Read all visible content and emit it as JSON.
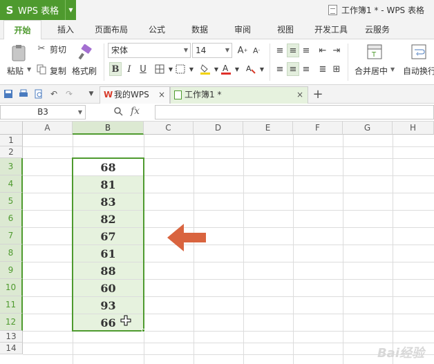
{
  "app": {
    "name": "WPS 表格",
    "logo": "S"
  },
  "window": {
    "title": "工作簿1 * - WPS 表格"
  },
  "ribbon_tabs": [
    "开始",
    "插入",
    "页面布局",
    "公式",
    "数据",
    "审阅",
    "视图",
    "开发工具",
    "云服务"
  ],
  "ribbon": {
    "paste": "粘贴",
    "cut": "剪切",
    "copy": "复制",
    "format_painter": "格式刷",
    "font_name": "宋体",
    "font_size": "14",
    "merge_center": "合并居中",
    "wrap": "自动换行",
    "bold": "B",
    "italic": "I",
    "underline": "U"
  },
  "doc_tabs": [
    {
      "label": "我的WPS"
    },
    {
      "label": "工作簿1 *"
    }
  ],
  "formula_bar": {
    "name_box": "B3",
    "fx": "fx",
    "value": ""
  },
  "grid": {
    "columns": [
      "A",
      "B",
      "C",
      "D",
      "E",
      "F",
      "G",
      "H"
    ],
    "rows": [
      "1",
      "2",
      "3",
      "4",
      "5",
      "6",
      "7",
      "8",
      "9",
      "10",
      "11",
      "12",
      "13",
      "14"
    ],
    "selected_column": "B",
    "selected_range": "B3:B12",
    "values_b": [
      "68",
      "81",
      "83",
      "82",
      "67",
      "61",
      "88",
      "60",
      "93",
      "66"
    ]
  },
  "colors": {
    "accent": "#4e9a2e",
    "selection": "#e6f2de",
    "arrow": "#d9643f"
  },
  "watermark": "Bai经验"
}
